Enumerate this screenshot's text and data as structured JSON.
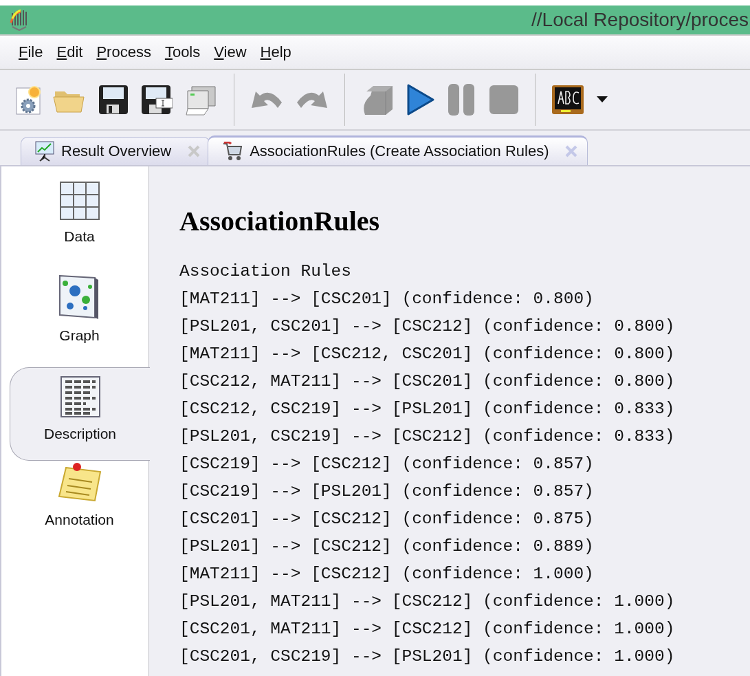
{
  "window": {
    "title": "//Local Repository/proces"
  },
  "menu": [
    "File",
    "Edit",
    "Process",
    "Tools",
    "View",
    "Help"
  ],
  "toolbar": [
    {
      "kind": "new",
      "disabled": false
    },
    {
      "kind": "open",
      "disabled": false
    },
    {
      "kind": "save",
      "disabled": false
    },
    {
      "kind": "saveas",
      "disabled": false
    },
    {
      "kind": "print",
      "disabled": false
    },
    {
      "kind": "sep"
    },
    {
      "kind": "undo",
      "disabled": true
    },
    {
      "kind": "redo",
      "disabled": true
    },
    {
      "kind": "sep"
    },
    {
      "kind": "cube",
      "disabled": true
    },
    {
      "kind": "play",
      "disabled": false
    },
    {
      "kind": "pause",
      "disabled": true
    },
    {
      "kind": "stop",
      "disabled": true
    },
    {
      "kind": "sep"
    },
    {
      "kind": "abc",
      "disabled": false
    },
    {
      "kind": "caret",
      "disabled": false
    }
  ],
  "tabs": [
    {
      "label": "Result Overview",
      "kind": "overview",
      "selected": false
    },
    {
      "label": "AssociationRules (Create Association Rules)",
      "kind": "cart",
      "selected": true
    }
  ],
  "sidebar": {
    "items": [
      {
        "label": "Data",
        "kind": "table",
        "selected": false
      },
      {
        "label": "Graph",
        "kind": "graph",
        "selected": false
      },
      {
        "label": "Description",
        "kind": "text",
        "selected": true
      },
      {
        "label": "Annotation",
        "kind": "note",
        "selected": false
      }
    ]
  },
  "content": {
    "heading": "AssociationRules",
    "subheading": "Association Rules",
    "rules": [
      "[MAT211] --> [CSC201] (confidence: 0.800)",
      "[PSL201, CSC201] --> [CSC212] (confidence: 0.800)",
      "[MAT211] --> [CSC212, CSC201] (confidence: 0.800)",
      "[CSC212, MAT211] --> [CSC201] (confidence: 0.800)",
      "[CSC212, CSC219] --> [PSL201] (confidence: 0.833)",
      "[PSL201, CSC219] --> [CSC212] (confidence: 0.833)",
      "[CSC219] --> [CSC212] (confidence: 0.857)",
      "[CSC219] --> [PSL201] (confidence: 0.857)",
      "[CSC201] --> [CSC212] (confidence: 0.875)",
      "[PSL201] --> [CSC212] (confidence: 0.889)",
      "[MAT211] --> [CSC212] (confidence: 1.000)",
      "[PSL201, MAT211] --> [CSC212] (confidence: 1.000)",
      "[CSC201, MAT211] --> [CSC212] (confidence: 1.000)",
      "[CSC201, CSC219] --> [PSL201] (confidence: 1.000)"
    ]
  }
}
